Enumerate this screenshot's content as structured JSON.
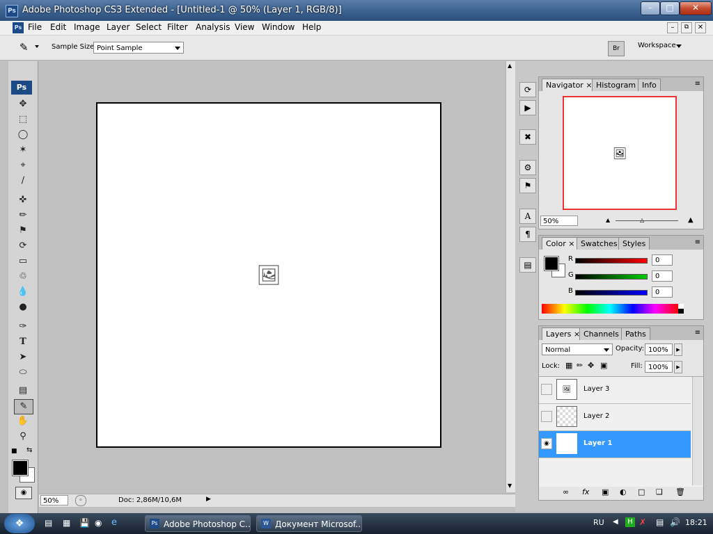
{
  "window": {
    "title": "Adobe Photoshop CS3 Extended - [Untitled-1 @ 50% (Layer 1, RGB/8)]",
    "app_icon": "Ps"
  },
  "menu": [
    "File",
    "Edit",
    "Image",
    "Layer",
    "Select",
    "Filter",
    "Analysis",
    "View",
    "Window",
    "Help"
  ],
  "options": {
    "sample_size_label": "Sample Size:",
    "sample_size_value": "Point Sample",
    "workspace_label": "Workspace"
  },
  "status": {
    "zoom": "50%",
    "doc": "Doc: 2,86M/10,6M"
  },
  "navigator": {
    "tabs": [
      "Navigator",
      "Histogram",
      "Info"
    ],
    "zoom": "50%"
  },
  "color": {
    "tabs": [
      "Color",
      "Swatches",
      "Styles"
    ],
    "r_label": "R",
    "g_label": "G",
    "b_label": "B",
    "r": "0",
    "g": "0",
    "b": "0"
  },
  "layers": {
    "tabs": [
      "Layers",
      "Channels",
      "Paths"
    ],
    "blend_mode": "Normal",
    "opacity_label": "Opacity:",
    "opacity": "100%",
    "lock_label": "Lock:",
    "fill_label": "Fill:",
    "fill": "100%",
    "items": [
      {
        "name": "Layer 3"
      },
      {
        "name": "Layer 2"
      },
      {
        "name": "Layer 1"
      }
    ]
  },
  "taskbar": {
    "items": [
      "Adobe Photoshop C...",
      "Документ Microsof..."
    ],
    "lang": "RU",
    "time": "18:21"
  },
  "colors": {
    "accent": "#3399ff",
    "titlebar": "#3d6290"
  }
}
